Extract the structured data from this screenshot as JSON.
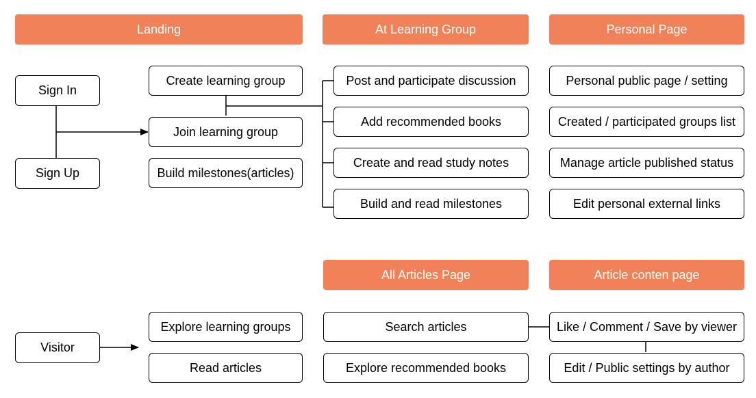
{
  "headers": {
    "landing": "Landing",
    "group": "At Learning Group",
    "personal": "Personal Page",
    "all_articles": "All Articles Page",
    "article_content": "Article conten page"
  },
  "auth": {
    "sign_in": "Sign In",
    "sign_up": "Sign Up",
    "visitor": "Visitor"
  },
  "landing_items": [
    "Create learning group",
    "Join learning group",
    "Build milestones(articles)"
  ],
  "group_items": [
    "Post and participate discussion",
    "Add recommended books",
    "Create and read study notes",
    "Build and read milestones"
  ],
  "personal_items": [
    "Personal public page / setting",
    "Created / participated groups list",
    "Manage article published status",
    "Edit personal external links"
  ],
  "visitor_items": [
    "Explore learning groups",
    "Read articles"
  ],
  "all_articles_items": [
    "Search articles",
    "Explore recommended books"
  ],
  "article_content_items": [
    "Like / Comment / Save by viewer",
    "Edit / Public settings by author"
  ],
  "colors": {
    "header_bg": "#f08159",
    "header_text": "#ffffff",
    "line": "#000000"
  }
}
